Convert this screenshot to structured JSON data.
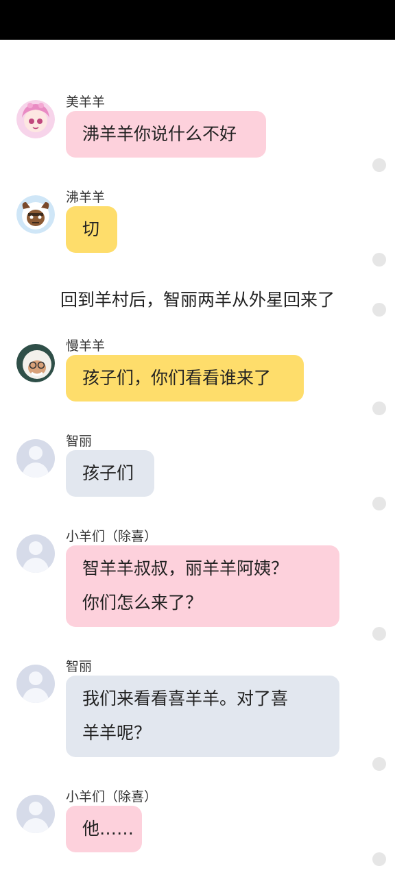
{
  "messages": [
    {
      "sender": "美羊羊",
      "text": "沸羊羊你说什么不好",
      "avatar": "meiyangyang-avatar"
    },
    {
      "sender": "沸羊羊",
      "text": "切",
      "avatar": "feiyangyang-avatar"
    },
    {
      "sender": "慢羊羊",
      "text": "孩子们，你们看看谁来了",
      "avatar": "manyangyang-avatar"
    },
    {
      "sender": "智丽",
      "text": "孩子们",
      "avatar": "default-avatar"
    },
    {
      "sender": "小羊们（除喜）",
      "lines": [
        "智羊羊叔叔，丽羊羊阿姨？",
        "你们怎么来了？"
      ],
      "avatar": "default-avatar"
    },
    {
      "sender": "智丽",
      "lines": [
        "我们来看看喜羊羊。对了喜",
        "羊羊呢？"
      ],
      "avatar": "default-avatar"
    },
    {
      "sender": "小羊们（除喜）",
      "text": "他……",
      "avatar": "default-avatar"
    }
  ],
  "narration": "回到羊村后，智丽两羊从外星回来了",
  "colors": {
    "pink": "#fdd1dc",
    "yellow": "#fedd6b",
    "gray": "#e2e7ef",
    "status_bar": "#000000"
  }
}
